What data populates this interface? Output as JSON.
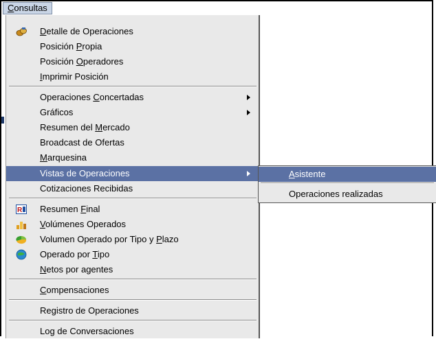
{
  "menubar": {
    "consultas": "Consultas"
  },
  "menu": {
    "items": [
      {
        "pre": "",
        "acc": "D",
        "post": "etalle de Operaciones",
        "icon": "coins-icon"
      },
      {
        "pre": "Posición ",
        "acc": "P",
        "post": "ropia"
      },
      {
        "pre": "Posición ",
        "acc": "O",
        "post": "peradores"
      },
      {
        "pre": "",
        "acc": "I",
        "post": "mprimir Posición"
      },
      {
        "pre": "Operaciones ",
        "acc": "C",
        "post": "oncertadas",
        "submenu": true
      },
      {
        "pre": "Gráficos",
        "acc": "",
        "post": "",
        "submenu": true
      },
      {
        "pre": "Resumen del ",
        "acc": "M",
        "post": "ercado"
      },
      {
        "pre": "Broadcast de Ofertas",
        "acc": "",
        "post": ""
      },
      {
        "pre": "",
        "acc": "M",
        "post": "arquesina"
      },
      {
        "pre": "Vistas de Operaciones",
        "acc": "",
        "post": "",
        "submenu": true
      },
      {
        "pre": "Cotizaciones Recibidas",
        "acc": "",
        "post": ""
      },
      {
        "pre": "Resumen ",
        "acc": "F",
        "post": "inal",
        "icon": "report-icon"
      },
      {
        "pre": "",
        "acc": "V",
        "post": "olúmenes Operados",
        "icon": "volume-chart-icon"
      },
      {
        "pre": "Volumen Operado por Tipo y ",
        "acc": "P",
        "post": "lazo",
        "icon": "pie-slice-icon"
      },
      {
        "pre": "Operado por ",
        "acc": "T",
        "post": "ipo",
        "icon": "globe-icon"
      },
      {
        "pre": "",
        "acc": "N",
        "post": "etos por agentes"
      },
      {
        "pre": "",
        "acc": "C",
        "post": "ompensaciones"
      },
      {
        "pre": "Re",
        "acc": "g",
        "post": "istro de Operaciones"
      },
      {
        "pre": "Log de Conversaciones",
        "acc": "",
        "post": ""
      }
    ]
  },
  "submenu": {
    "items": [
      {
        "pre": "",
        "acc": "A",
        "post": "sistente"
      },
      {
        "pre": "Operaciones realizadas",
        "acc": "",
        "post": ""
      }
    ]
  },
  "colors": {
    "highlight": "#5b71a4",
    "menu_bg": "#e9e9e9"
  }
}
